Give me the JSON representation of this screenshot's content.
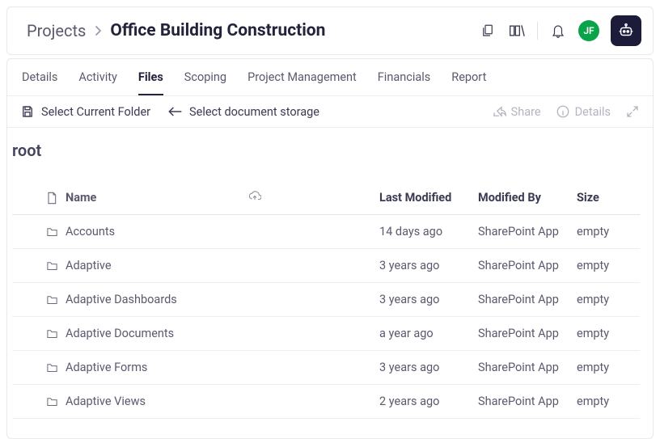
{
  "breadcrumb": {
    "root": "Projects",
    "title": "Office Building Construction"
  },
  "avatar": "JF",
  "tabs": [
    "Details",
    "Activity",
    "Files",
    "Scoping",
    "Project Management",
    "Financials",
    "Report"
  ],
  "active_tab": 2,
  "toolbar": {
    "select_folder": "Select Current Folder",
    "select_storage": "Select document storage",
    "share": "Share",
    "details": "Details"
  },
  "root_label": "root",
  "columns": {
    "name": "Name",
    "modified": "Last Modified",
    "by": "Modified By",
    "size": "Size"
  },
  "rows": [
    {
      "name": "Accounts",
      "modified": "14 days ago",
      "by": "SharePoint App",
      "size": "empty"
    },
    {
      "name": "Adaptive",
      "modified": "3 years ago",
      "by": "SharePoint App",
      "size": "empty"
    },
    {
      "name": "Adaptive Dashboards",
      "modified": "3 years ago",
      "by": "SharePoint App",
      "size": "empty"
    },
    {
      "name": "Adaptive Documents",
      "modified": "a year ago",
      "by": "SharePoint App",
      "size": "empty"
    },
    {
      "name": "Adaptive Forms",
      "modified": "3 years ago",
      "by": "SharePoint App",
      "size": "empty"
    },
    {
      "name": "Adaptive Views",
      "modified": "2 years ago",
      "by": "SharePoint App",
      "size": "empty"
    }
  ]
}
